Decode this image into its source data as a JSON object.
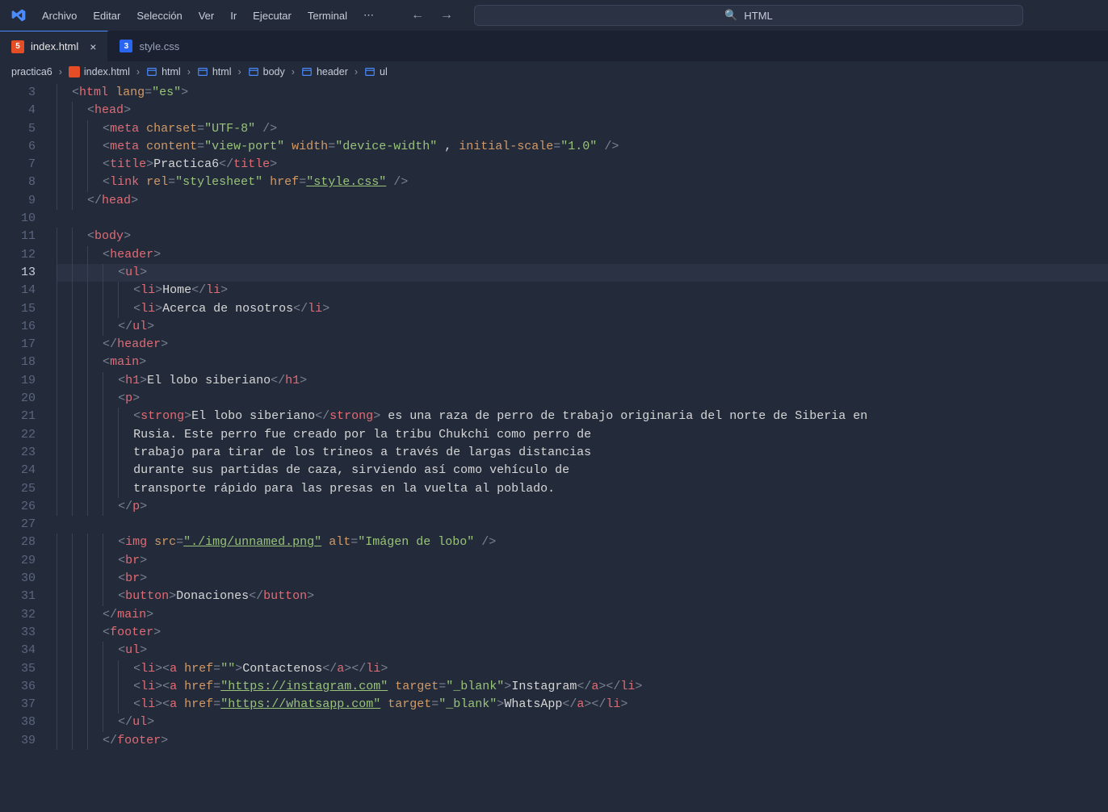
{
  "menubar": {
    "items": [
      "Archivo",
      "Editar",
      "Selección",
      "Ver",
      "Ir",
      "Ejecutar",
      "Terminal"
    ],
    "search_text": "HTML"
  },
  "tabs": [
    {
      "label": "index.html",
      "type": "html",
      "active": true,
      "dirty": false
    },
    {
      "label": "style.css",
      "type": "css",
      "active": false,
      "dirty": false
    }
  ],
  "breadcrumb": {
    "segments": [
      "practica6",
      "index.html",
      "html",
      "html",
      "body",
      "header",
      "ul"
    ]
  },
  "editor": {
    "first_line": 3,
    "current_line": 13,
    "lines": [
      {
        "n": 3,
        "indent": 1,
        "tokens": [
          [
            "p",
            "<"
          ],
          [
            "tag",
            "html"
          ],
          [
            "t",
            " "
          ],
          [
            "attr",
            "lang"
          ],
          [
            "p",
            "="
          ],
          [
            "str",
            "\"es\""
          ],
          [
            "p",
            ">"
          ]
        ]
      },
      {
        "n": 4,
        "indent": 2,
        "tokens": [
          [
            "p",
            "<"
          ],
          [
            "tag",
            "head"
          ],
          [
            "p",
            ">"
          ]
        ]
      },
      {
        "n": 5,
        "indent": 3,
        "tokens": [
          [
            "p",
            "<"
          ],
          [
            "tag",
            "meta"
          ],
          [
            "t",
            " "
          ],
          [
            "attr",
            "charset"
          ],
          [
            "p",
            "="
          ],
          [
            "str",
            "\"UTF-8\""
          ],
          [
            "t",
            " "
          ],
          [
            "p",
            "/>"
          ]
        ]
      },
      {
        "n": 6,
        "indent": 3,
        "tokens": [
          [
            "p",
            "<"
          ],
          [
            "tag",
            "meta"
          ],
          [
            "t",
            " "
          ],
          [
            "attr",
            "content"
          ],
          [
            "p",
            "="
          ],
          [
            "str",
            "\"view-port\""
          ],
          [
            "t",
            " "
          ],
          [
            "attr",
            "width"
          ],
          [
            "p",
            "="
          ],
          [
            "str",
            "\"device-width\""
          ],
          [
            "t",
            " , "
          ],
          [
            "attr",
            "initial-scale"
          ],
          [
            "p",
            "="
          ],
          [
            "str",
            "\"1.0\""
          ],
          [
            "t",
            " "
          ],
          [
            "p",
            "/>"
          ]
        ]
      },
      {
        "n": 7,
        "indent": 3,
        "tokens": [
          [
            "p",
            "<"
          ],
          [
            "tag",
            "title"
          ],
          [
            "p",
            ">"
          ],
          [
            "t",
            "Practica6"
          ],
          [
            "p",
            "</"
          ],
          [
            "tag",
            "title"
          ],
          [
            "p",
            ">"
          ]
        ]
      },
      {
        "n": 8,
        "indent": 3,
        "tokens": [
          [
            "p",
            "<"
          ],
          [
            "tag",
            "link"
          ],
          [
            "t",
            " "
          ],
          [
            "attr",
            "rel"
          ],
          [
            "p",
            "="
          ],
          [
            "str",
            "\"stylesheet\""
          ],
          [
            "t",
            " "
          ],
          [
            "attr",
            "href"
          ],
          [
            "p",
            "="
          ],
          [
            "stru",
            "\"style.css\""
          ],
          [
            "t",
            " "
          ],
          [
            "p",
            "/>"
          ]
        ]
      },
      {
        "n": 9,
        "indent": 2,
        "tokens": [
          [
            "p",
            "</"
          ],
          [
            "tag",
            "head"
          ],
          [
            "p",
            ">"
          ]
        ]
      },
      {
        "n": 10,
        "indent": 0,
        "tokens": []
      },
      {
        "n": 11,
        "indent": 2,
        "tokens": [
          [
            "p",
            "<"
          ],
          [
            "tag",
            "body"
          ],
          [
            "p",
            ">"
          ]
        ]
      },
      {
        "n": 12,
        "indent": 3,
        "tokens": [
          [
            "p",
            "<"
          ],
          [
            "tag",
            "header"
          ],
          [
            "p",
            ">"
          ]
        ]
      },
      {
        "n": 13,
        "indent": 4,
        "tokens": [
          [
            "p",
            "<"
          ],
          [
            "tag",
            "ul"
          ],
          [
            "p",
            ">"
          ]
        ]
      },
      {
        "n": 14,
        "indent": 5,
        "tokens": [
          [
            "p",
            "<"
          ],
          [
            "tag",
            "li"
          ],
          [
            "p",
            ">"
          ],
          [
            "t",
            "Home"
          ],
          [
            "p",
            "</"
          ],
          [
            "tag",
            "li"
          ],
          [
            "p",
            ">"
          ]
        ]
      },
      {
        "n": 15,
        "indent": 5,
        "tokens": [
          [
            "p",
            "<"
          ],
          [
            "tag",
            "li"
          ],
          [
            "p",
            ">"
          ],
          [
            "t",
            "Acerca de nosotros"
          ],
          [
            "p",
            "</"
          ],
          [
            "tag",
            "li"
          ],
          [
            "p",
            ">"
          ]
        ]
      },
      {
        "n": 16,
        "indent": 4,
        "tokens": [
          [
            "p",
            "</"
          ],
          [
            "tag",
            "ul"
          ],
          [
            "p",
            ">"
          ]
        ]
      },
      {
        "n": 17,
        "indent": 3,
        "tokens": [
          [
            "p",
            "</"
          ],
          [
            "tag",
            "header"
          ],
          [
            "p",
            ">"
          ]
        ]
      },
      {
        "n": 18,
        "indent": 3,
        "tokens": [
          [
            "p",
            "<"
          ],
          [
            "tag",
            "main"
          ],
          [
            "p",
            ">"
          ]
        ]
      },
      {
        "n": 19,
        "indent": 4,
        "tokens": [
          [
            "p",
            "<"
          ],
          [
            "tag",
            "h1"
          ],
          [
            "p",
            ">"
          ],
          [
            "t",
            "El lobo siberiano"
          ],
          [
            "p",
            "</"
          ],
          [
            "tag",
            "h1"
          ],
          [
            "p",
            ">"
          ]
        ]
      },
      {
        "n": 20,
        "indent": 4,
        "tokens": [
          [
            "p",
            "<"
          ],
          [
            "tag",
            "p"
          ],
          [
            "p",
            ">"
          ]
        ]
      },
      {
        "n": 21,
        "indent": 5,
        "tokens": [
          [
            "p",
            "<"
          ],
          [
            "tag",
            "strong"
          ],
          [
            "p",
            ">"
          ],
          [
            "t",
            "El lobo siberiano"
          ],
          [
            "p",
            "</"
          ],
          [
            "tag",
            "strong"
          ],
          [
            "p",
            ">"
          ],
          [
            "t",
            " es una raza de perro de trabajo originaria del norte de Siberia en"
          ]
        ]
      },
      {
        "n": 22,
        "indent": 5,
        "tokens": [
          [
            "t",
            "Rusia. Este perro fue creado por la tribu Chukchi como perro de"
          ]
        ]
      },
      {
        "n": 23,
        "indent": 5,
        "tokens": [
          [
            "t",
            "trabajo para tirar de los trineos a través de largas distancias"
          ]
        ]
      },
      {
        "n": 24,
        "indent": 5,
        "tokens": [
          [
            "t",
            "durante sus partidas de caza, sirviendo así como vehículo de"
          ]
        ]
      },
      {
        "n": 25,
        "indent": 5,
        "tokens": [
          [
            "t",
            "transporte rápido para las presas en la vuelta al poblado."
          ]
        ]
      },
      {
        "n": 26,
        "indent": 4,
        "tokens": [
          [
            "p",
            "</"
          ],
          [
            "tag",
            "p"
          ],
          [
            "p",
            ">"
          ]
        ]
      },
      {
        "n": 27,
        "indent": 0,
        "tokens": []
      },
      {
        "n": 28,
        "indent": 4,
        "tokens": [
          [
            "p",
            "<"
          ],
          [
            "tag",
            "img"
          ],
          [
            "t",
            " "
          ],
          [
            "attr",
            "src"
          ],
          [
            "p",
            "="
          ],
          [
            "stru",
            "\"./img/unnamed.png\""
          ],
          [
            "t",
            " "
          ],
          [
            "attr",
            "alt"
          ],
          [
            "p",
            "="
          ],
          [
            "str",
            "\"Imágen de lobo\""
          ],
          [
            "t",
            " "
          ],
          [
            "p",
            "/>"
          ]
        ]
      },
      {
        "n": 29,
        "indent": 4,
        "tokens": [
          [
            "p",
            "<"
          ],
          [
            "tag",
            "br"
          ],
          [
            "p",
            ">"
          ]
        ]
      },
      {
        "n": 30,
        "indent": 4,
        "tokens": [
          [
            "p",
            "<"
          ],
          [
            "tag",
            "br"
          ],
          [
            "p",
            ">"
          ]
        ]
      },
      {
        "n": 31,
        "indent": 4,
        "tokens": [
          [
            "p",
            "<"
          ],
          [
            "tag",
            "button"
          ],
          [
            "p",
            ">"
          ],
          [
            "t",
            "Donaciones"
          ],
          [
            "p",
            "</"
          ],
          [
            "tag",
            "button"
          ],
          [
            "p",
            ">"
          ]
        ]
      },
      {
        "n": 32,
        "indent": 3,
        "tokens": [
          [
            "p",
            "</"
          ],
          [
            "tag",
            "main"
          ],
          [
            "p",
            ">"
          ]
        ]
      },
      {
        "n": 33,
        "indent": 3,
        "tokens": [
          [
            "p",
            "<"
          ],
          [
            "tag",
            "footer"
          ],
          [
            "p",
            ">"
          ]
        ]
      },
      {
        "n": 34,
        "indent": 4,
        "tokens": [
          [
            "p",
            "<"
          ],
          [
            "tag",
            "ul"
          ],
          [
            "p",
            ">"
          ]
        ]
      },
      {
        "n": 35,
        "indent": 5,
        "tokens": [
          [
            "p",
            "<"
          ],
          [
            "tag",
            "li"
          ],
          [
            "p",
            "><"
          ],
          [
            "tag",
            "a"
          ],
          [
            "t",
            " "
          ],
          [
            "attr",
            "href"
          ],
          [
            "p",
            "="
          ],
          [
            "str",
            "\"\""
          ],
          [
            "p",
            ">"
          ],
          [
            "t",
            "Contactenos"
          ],
          [
            "p",
            "</"
          ],
          [
            "tag",
            "a"
          ],
          [
            "p",
            "></"
          ],
          [
            "tag",
            "li"
          ],
          [
            "p",
            ">"
          ]
        ]
      },
      {
        "n": 36,
        "indent": 5,
        "tokens": [
          [
            "p",
            "<"
          ],
          [
            "tag",
            "li"
          ],
          [
            "p",
            "><"
          ],
          [
            "tag",
            "a"
          ],
          [
            "t",
            " "
          ],
          [
            "attr",
            "href"
          ],
          [
            "p",
            "="
          ],
          [
            "stru",
            "\"https://instagram.com\""
          ],
          [
            "t",
            " "
          ],
          [
            "attr",
            "target"
          ],
          [
            "p",
            "="
          ],
          [
            "str",
            "\"_blank\""
          ],
          [
            "p",
            ">"
          ],
          [
            "t",
            "Instagram"
          ],
          [
            "p",
            "</"
          ],
          [
            "tag",
            "a"
          ],
          [
            "p",
            "></"
          ],
          [
            "tag",
            "li"
          ],
          [
            "p",
            ">"
          ]
        ]
      },
      {
        "n": 37,
        "indent": 5,
        "tokens": [
          [
            "p",
            "<"
          ],
          [
            "tag",
            "li"
          ],
          [
            "p",
            "><"
          ],
          [
            "tag",
            "a"
          ],
          [
            "t",
            " "
          ],
          [
            "attr",
            "href"
          ],
          [
            "p",
            "="
          ],
          [
            "stru",
            "\"https://whatsapp.com\""
          ],
          [
            "t",
            " "
          ],
          [
            "attr",
            "target"
          ],
          [
            "p",
            "="
          ],
          [
            "str",
            "\"_blank\""
          ],
          [
            "p",
            ">"
          ],
          [
            "t",
            "WhatsApp"
          ],
          [
            "p",
            "</"
          ],
          [
            "tag",
            "a"
          ],
          [
            "p",
            "></"
          ],
          [
            "tag",
            "li"
          ],
          [
            "p",
            ">"
          ]
        ]
      },
      {
        "n": 38,
        "indent": 4,
        "tokens": [
          [
            "p",
            "</"
          ],
          [
            "tag",
            "ul"
          ],
          [
            "p",
            ">"
          ]
        ]
      },
      {
        "n": 39,
        "indent": 3,
        "tokens": [
          [
            "p",
            "</"
          ],
          [
            "tag",
            "footer"
          ],
          [
            "p",
            ">"
          ]
        ]
      }
    ]
  }
}
